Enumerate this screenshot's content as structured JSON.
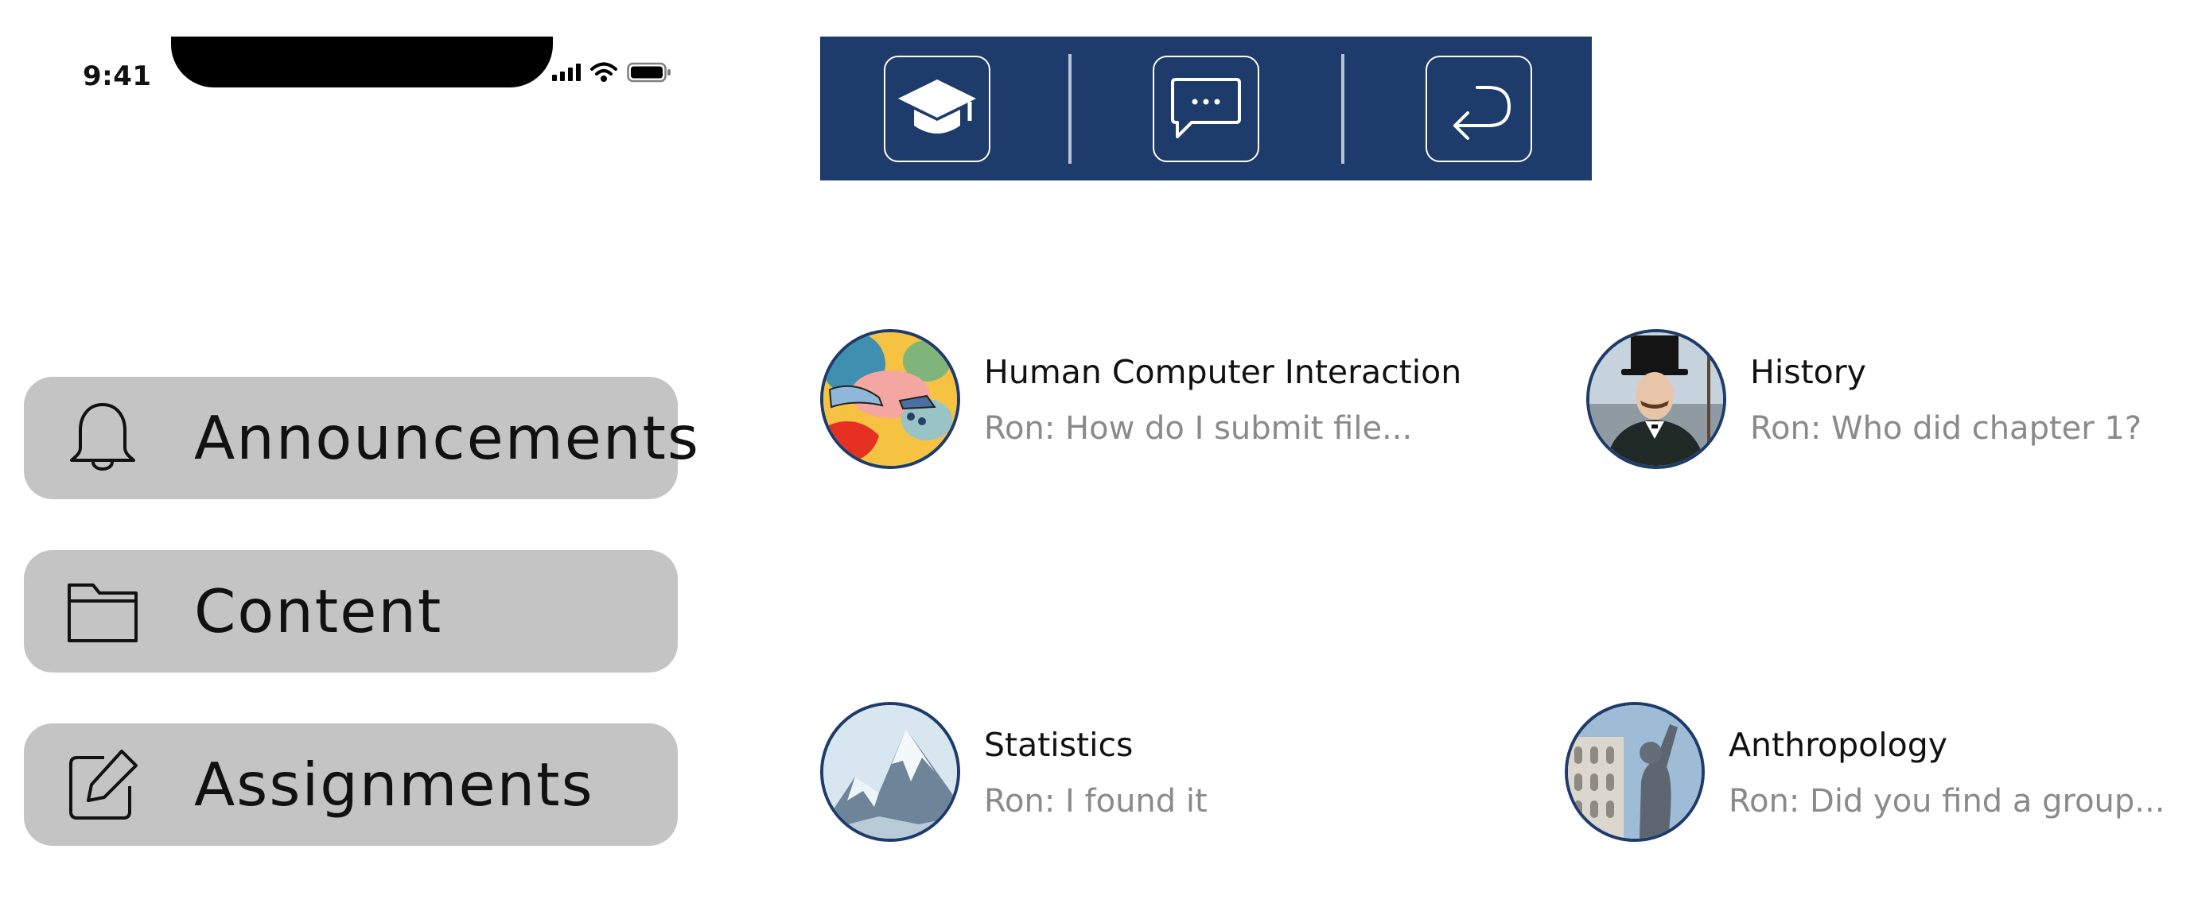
{
  "status_bar": {
    "time": "9:41"
  },
  "toolbar": {
    "buttons": [
      {
        "icon": "graduation-cap-icon"
      },
      {
        "icon": "chat-bubble-icon"
      },
      {
        "icon": "return-arrow-icon"
      }
    ],
    "background_color": "#1d3b6b"
  },
  "menu": {
    "items": [
      {
        "label": "Announcements",
        "icon": "bell-icon"
      },
      {
        "label": "Content",
        "icon": "folder-icon"
      },
      {
        "label": "Assignments",
        "icon": "edit-icon"
      }
    ],
    "button_color": "#c4c4c4"
  },
  "chats": [
    {
      "title": "Human Computer Interaction",
      "preview": "Ron: How do I submit file...",
      "avatar": "artwork-hands-avatar"
    },
    {
      "title": "History",
      "preview": "Ron: Who did chapter 1?",
      "avatar": "top-hat-man-avatar"
    },
    {
      "title": "Statistics",
      "preview": "Ron: I found it",
      "avatar": "snowy-mountain-avatar"
    },
    {
      "title": "Anthropology",
      "preview": "Ron: Did you find a group...",
      "avatar": "statue-avatar"
    }
  ]
}
